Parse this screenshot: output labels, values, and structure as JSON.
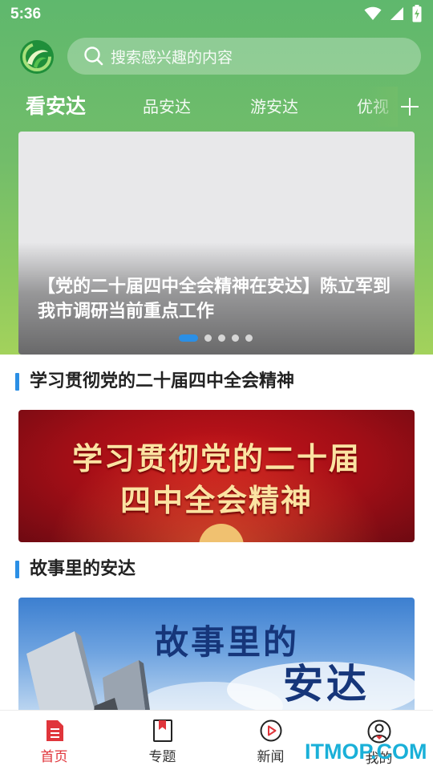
{
  "status_bar": {
    "time": "5:36"
  },
  "search": {
    "placeholder": "搜索感兴趣的内容"
  },
  "tabs": [
    {
      "label": "看安达",
      "active": true
    },
    {
      "label": "品安达",
      "active": false
    },
    {
      "label": "游安达",
      "active": false
    },
    {
      "label": "优视",
      "active": false
    }
  ],
  "banner": {
    "title": "【党的二十届四中全会精神在安达】陈立军到我市调研当前重点工作",
    "slide_count": 5,
    "active_slide": 1
  },
  "sections": [
    {
      "title": "学习贯彻党的二十届四中全会精神",
      "image_text": [
        "学习贯彻党的二十届",
        "四中全会精神"
      ]
    },
    {
      "title": "故事里的安达",
      "image_text": [
        "故事里的",
        "安达"
      ]
    }
  ],
  "bottom_nav": [
    {
      "label": "首页",
      "icon": "home-doc-icon",
      "active": true
    },
    {
      "label": "专题",
      "icon": "bookmark-icon",
      "active": false
    },
    {
      "label": "新闻",
      "icon": "play-circle-icon",
      "active": false
    },
    {
      "label": "我的",
      "icon": "user-heart-icon",
      "active": false
    }
  ],
  "watermark": "ITMOP.COM",
  "colors": {
    "header_green": "#72bd6a",
    "accent_blue": "#2b8fe5",
    "active_red": "#e0353b"
  }
}
